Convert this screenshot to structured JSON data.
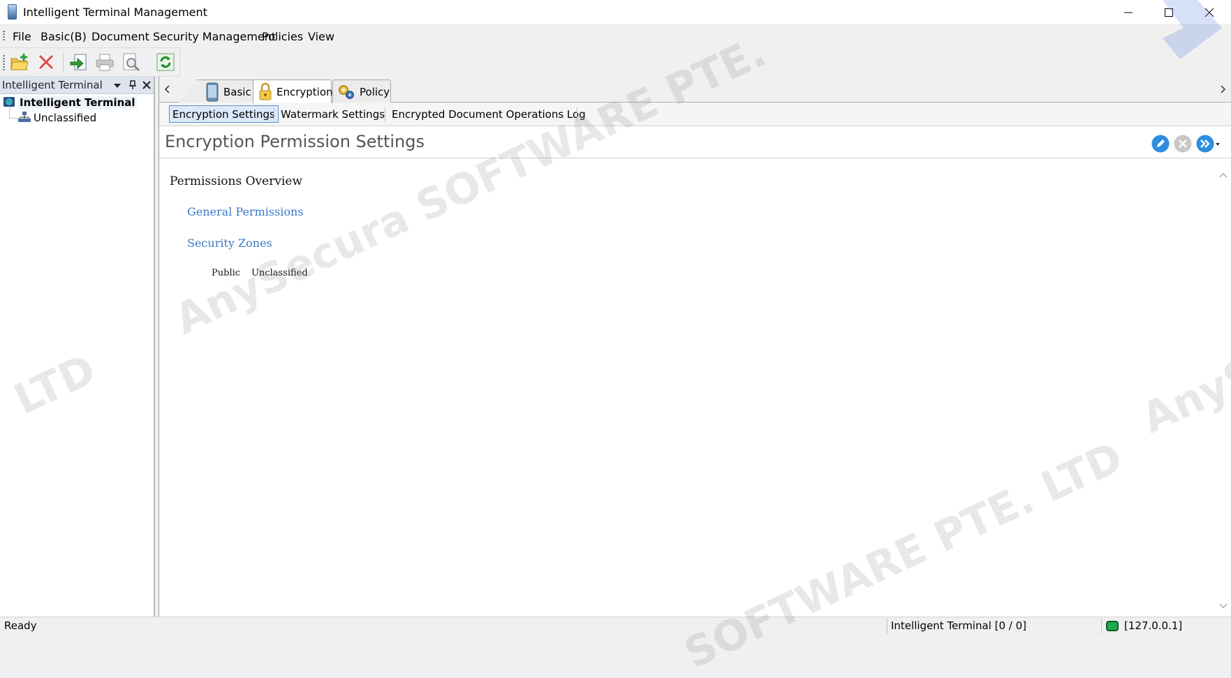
{
  "window": {
    "title": "Intelligent Terminal Management"
  },
  "menu": {
    "items": [
      "File",
      "Basic(B)",
      "Document Security Management",
      "Policies",
      "View"
    ]
  },
  "toolbar": {
    "buttons": [
      "new-folder-icon",
      "delete-icon",
      "import-icon",
      "print-icon",
      "print-preview-icon",
      "refresh-icon"
    ]
  },
  "left_panel": {
    "title": "Intelligent Terminal",
    "tree": {
      "root": "Intelligent Terminal",
      "children": [
        "Unclassified"
      ]
    }
  },
  "doc_tabs": [
    {
      "label": "Basic",
      "icon": "phone-icon",
      "active": false
    },
    {
      "label": "Encryption",
      "icon": "lock-icon",
      "active": true
    },
    {
      "label": "Policy",
      "icon": "policy-gear-icon",
      "active": false
    }
  ],
  "sub_tabs": [
    {
      "label": "Encryption Settings",
      "active": true
    },
    {
      "label": "Watermark Settings",
      "active": false
    },
    {
      "label": "Encrypted Document Operations Log",
      "active": false
    }
  ],
  "settings": {
    "title": "Encryption Permission Settings",
    "overview_heading": "Permissions Overview",
    "general_permissions_link": "General Permissions",
    "security_zones_link": "Security Zones",
    "zones": [
      {
        "name": "Public",
        "level": "Unclassified"
      }
    ]
  },
  "status_bar": {
    "status": "Ready",
    "terminal_count": "Intelligent Terminal [0 / 0]",
    "server_ip": "[127.0.0.1]"
  },
  "watermark": {
    "text1": "AnySecura SOFTWARE PTE.",
    "text2": "LTD",
    "text3": "SOFTWARE PTE. LTD",
    "text4": "AnySe"
  },
  "colors": {
    "accent_blue": "#2d8ee0",
    "link": "#3a78c9",
    "status_green": "#1fa84b"
  }
}
